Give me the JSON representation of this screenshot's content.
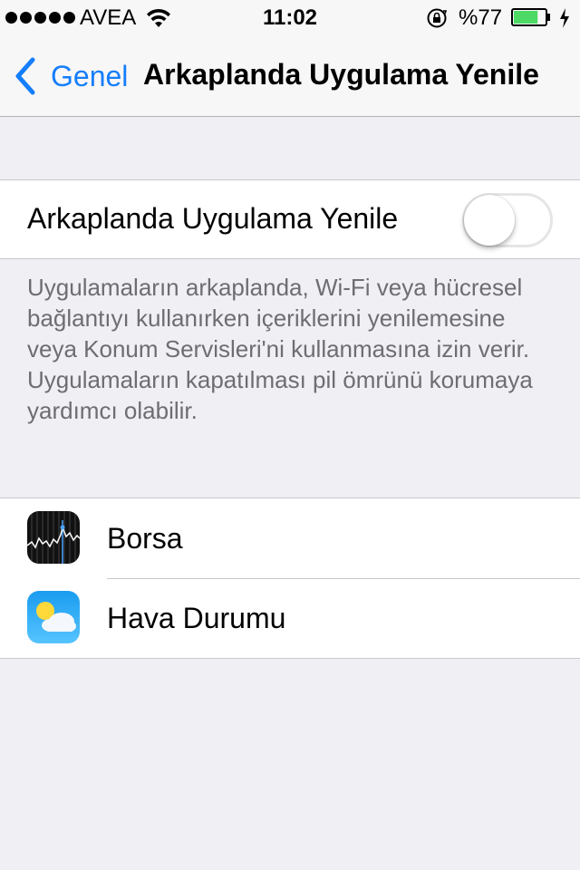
{
  "status_bar": {
    "carrier": "AVEA",
    "time": "11:02",
    "battery_percent": "%77",
    "battery_level": 0.77,
    "battery_color": "#4cd964",
    "icons": [
      "signal-dots-icon",
      "wifi-icon",
      "rotation-lock-icon",
      "battery-icon",
      "charging-bolt-icon"
    ]
  },
  "nav": {
    "back_label": "Genel",
    "title": "Arkaplanda Uygulama Yenile",
    "accent_color": "#157efb"
  },
  "main_toggle": {
    "label": "Arkaplanda Uygulama Yenile",
    "state": "off"
  },
  "footer": {
    "text": "Uygulamaların arkaplanda, Wi-Fi veya hücresel bağlantıyı kullanırken içeriklerini yenilemesine veya Konum Servisleri'ni kullanmasına izin verir. Uygulamaların kapatılması pil ömrünü korumaya yardımcı olabilir."
  },
  "apps": [
    {
      "name": "Borsa",
      "icon": "stocks-icon"
    },
    {
      "name": "Hava Durumu",
      "icon": "weather-icon"
    }
  ]
}
